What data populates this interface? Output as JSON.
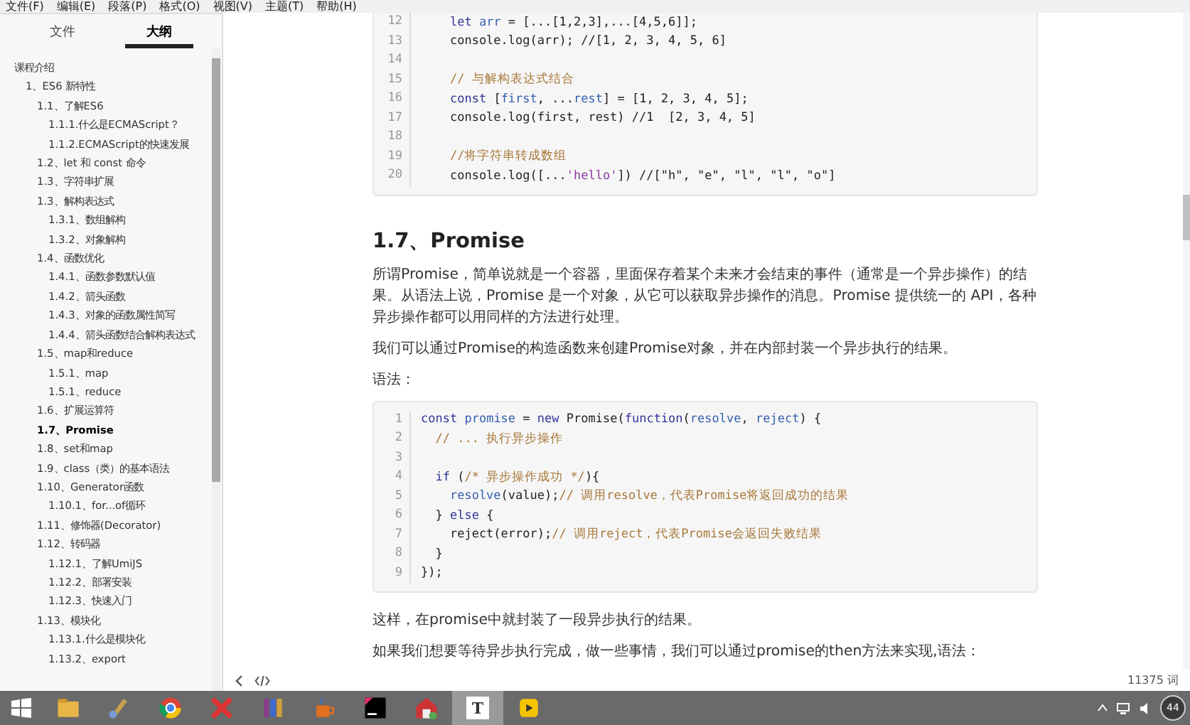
{
  "menu_bar": [
    "文件(F)",
    "编辑(E)",
    "段落(P)",
    "格式(O)",
    "视图(V)",
    "主题(T)",
    "帮助(H)"
  ],
  "sidebar": {
    "tabs": [
      {
        "label": "文件",
        "selected": false
      },
      {
        "label": "大纲",
        "selected": true
      }
    ],
    "outline": [
      {
        "label": "课程介绍",
        "selected": false,
        "children": [
          {
            "label": "1、ES6 新特性",
            "selected": false,
            "children": [
              {
                "label": "1.1、了解ES6",
                "selected": false,
                "children": [
                  {
                    "label": "1.1.1.什么是ECMAScript？",
                    "selected": false
                  },
                  {
                    "label": "1.1.2.ECMAScript的快速发展",
                    "selected": false
                  }
                ]
              },
              {
                "label": "1.2、let 和 const 命令",
                "selected": false
              },
              {
                "label": "1.3、字符串扩展",
                "selected": false
              },
              {
                "label": "1.3、解构表达式",
                "selected": false,
                "children": [
                  {
                    "label": "1.3.1、数组解构",
                    "selected": false
                  },
                  {
                    "label": "1.3.2、对象解构",
                    "selected": false
                  }
                ]
              },
              {
                "label": "1.4、函数优化",
                "selected": false,
                "children": [
                  {
                    "label": "1.4.1、函数参数默认值",
                    "selected": false
                  },
                  {
                    "label": "1.4.2、箭头函数",
                    "selected": false
                  },
                  {
                    "label": "1.4.3、对象的函数属性简写",
                    "selected": false
                  },
                  {
                    "label": "1.4.4、箭头函数结合解构表达式",
                    "selected": false
                  }
                ]
              },
              {
                "label": "1.5、map和reduce",
                "selected": false,
                "children": [
                  {
                    "label": "1.5.1、map",
                    "selected": false
                  },
                  {
                    "label": "1.5.1、reduce",
                    "selected": false
                  }
                ]
              },
              {
                "label": "1.6、扩展运算符",
                "selected": false
              },
              {
                "label": "1.7、Promise",
                "selected": true
              },
              {
                "label": "1.8、set和map",
                "selected": false
              },
              {
                "label": "1.9、class（类）的基本语法",
                "selected": false
              },
              {
                "label": "1.10、Generator函数",
                "selected": false,
                "children": [
                  {
                    "label": "1.10.1、for...of循环",
                    "selected": false
                  }
                ]
              },
              {
                "label": "1.11、修饰器(Decorator)",
                "selected": false
              },
              {
                "label": "1.12、转码器",
                "selected": false,
                "children": [
                  {
                    "label": "1.12.1、了解UmiJS",
                    "selected": false
                  },
                  {
                    "label": "1.12.2、部署安装",
                    "selected": false
                  },
                  {
                    "label": "1.12.3、快速入门",
                    "selected": false
                  }
                ]
              },
              {
                "label": "1.13、模块化",
                "selected": false,
                "children": [
                  {
                    "label": "1.13.1.什么是模块化",
                    "selected": false
                  },
                  {
                    "label": "1.13.2、export",
                    "selected": false
                  }
                ]
              }
            ]
          }
        ]
      }
    ]
  },
  "document": {
    "blocks": [
      {
        "kind": "code",
        "cut_top": true,
        "lines": [
          {
            "num": "12",
            "tokens": [
              {
                "t": "    let ",
                "kind": "kw"
              },
              {
                "t": "arr",
                "kind": "var"
              },
              {
                "t": " = [...[1,2,3],...[4,5,6]];",
                "kind": "plain"
              }
            ]
          },
          {
            "num": "13",
            "tokens": [
              {
                "t": "    console.log(arr); //[1, 2, 3, 4, 5, 6]",
                "kind": "plain"
              }
            ]
          },
          {
            "num": "14"
          },
          {
            "num": "15",
            "tokens": [
              {
                "t": "    // 与解构表达式结合",
                "kind": "comment"
              }
            ]
          },
          {
            "num": "16",
            "tokens": [
              {
                "t": "    const ",
                "kind": "kw"
              },
              {
                "t": "[",
                "kind": "plain"
              },
              {
                "t": "first",
                "kind": "var"
              },
              {
                "t": ", ...",
                "kind": "plain"
              },
              {
                "t": "rest",
                "kind": "var"
              },
              {
                "t": "] = [1, 2, 3, 4, 5];",
                "kind": "plain"
              }
            ]
          },
          {
            "num": "17",
            "tokens": [
              {
                "t": "    console.log(first, rest) //1  [2, 3, 4, 5]",
                "kind": "plain"
              }
            ]
          },
          {
            "num": "18"
          },
          {
            "num": "19",
            "tokens": [
              {
                "t": "    //将字符串转成数组",
                "kind": "comment"
              }
            ]
          },
          {
            "num": "20",
            "tokens": [
              {
                "t": "    console.log([...",
                "kind": "plain"
              },
              {
                "t": "'hello'",
                "kind": "str"
              },
              {
                "t": "]) //[\"h\", \"e\", \"l\", \"l\", \"o\"]",
                "kind": "plain"
              }
            ]
          }
        ]
      },
      {
        "kind": "heading",
        "text": "1.7、Promise"
      },
      {
        "kind": "paragraph",
        "text": "所谓Promise，简单说就是一个容器，里面保存着某个未来才会结束的事件（通常是一个异步操作）的结果。从语法上说，Promise 是一个对象，从它可以获取异步操作的消息。Promise 提供统一的 API，各种异步操作都可以用同样的方法进行处理。"
      },
      {
        "kind": "paragraph",
        "text": "我们可以通过Promise的构造函数来创建Promise对象，并在内部封装一个异步执行的结果。"
      },
      {
        "kind": "paragraph",
        "text": "语法："
      },
      {
        "kind": "code",
        "cut_top": false,
        "lines": [
          {
            "num": "1",
            "tokens": [
              {
                "t": "const ",
                "kind": "kw"
              },
              {
                "t": "promise",
                "kind": "var"
              },
              {
                "t": " = ",
                "kind": "plain"
              },
              {
                "t": "new ",
                "kind": "kw"
              },
              {
                "t": "Promise(",
                "kind": "plain"
              },
              {
                "t": "function",
                "kind": "kw"
              },
              {
                "t": "(",
                "kind": "plain"
              },
              {
                "t": "resolve",
                "kind": "var"
              },
              {
                "t": ", ",
                "kind": "plain"
              },
              {
                "t": "reject",
                "kind": "var"
              },
              {
                "t": ") {",
                "kind": "plain"
              }
            ]
          },
          {
            "num": "2",
            "tokens": [
              {
                "t": "  // ... 执行异步操作",
                "kind": "comment"
              }
            ]
          },
          {
            "num": "3"
          },
          {
            "num": "4",
            "tokens": [
              {
                "t": "  if ",
                "kind": "kw"
              },
              {
                "t": "(",
                "kind": "plain"
              },
              {
                "t": "/* 异步操作成功 */",
                "kind": "comment"
              },
              {
                "t": "){",
                "kind": "plain"
              }
            ]
          },
          {
            "num": "5",
            "tokens": [
              {
                "t": "    resolve",
                "kind": "var"
              },
              {
                "t": "(value);",
                "kind": "plain"
              },
              {
                "t": "// 调用resolve，代表Promise将返回成功的结果",
                "kind": "comment"
              }
            ]
          },
          {
            "num": "6",
            "tokens": [
              {
                "t": "  } ",
                "kind": "plain"
              },
              {
                "t": "else",
                "kind": "kw"
              },
              {
                "t": " {",
                "kind": "plain"
              }
            ]
          },
          {
            "num": "7",
            "tokens": [
              {
                "t": "    reject(error);",
                "kind": "plain"
              },
              {
                "t": "// 调用reject，代表Promise会返回失败结果",
                "kind": "comment"
              }
            ]
          },
          {
            "num": "8",
            "tokens": [
              {
                "t": "  }",
                "kind": "plain"
              }
            ]
          },
          {
            "num": "9",
            "tokens": [
              {
                "t": "});",
                "kind": "plain"
              }
            ]
          }
        ]
      },
      {
        "kind": "paragraph",
        "text": "这样，在promise中就封装了一段异步执行的结果。"
      },
      {
        "kind": "paragraph",
        "text": "如果我们想要等待异步执行完成，做一些事情，我们可以通过promise的then方法来实现,语法："
      }
    ]
  },
  "status_bar": {
    "word_count": "11375 词"
  },
  "taskbar": {
    "apps": [
      {
        "kind": "folder",
        "active": false
      },
      {
        "kind": "brush",
        "active": false
      },
      {
        "kind": "browser",
        "active": false
      },
      {
        "kind": "mindmap",
        "active": false
      },
      {
        "kind": "books",
        "active": false
      },
      {
        "kind": "cup",
        "active": false
      },
      {
        "kind": "ide",
        "active": false
      },
      {
        "kind": "house",
        "active": false
      },
      {
        "kind": "letter",
        "glyph": "T",
        "active": true
      },
      {
        "kind": "player",
        "active": false
      }
    ],
    "badge": "44"
  }
}
